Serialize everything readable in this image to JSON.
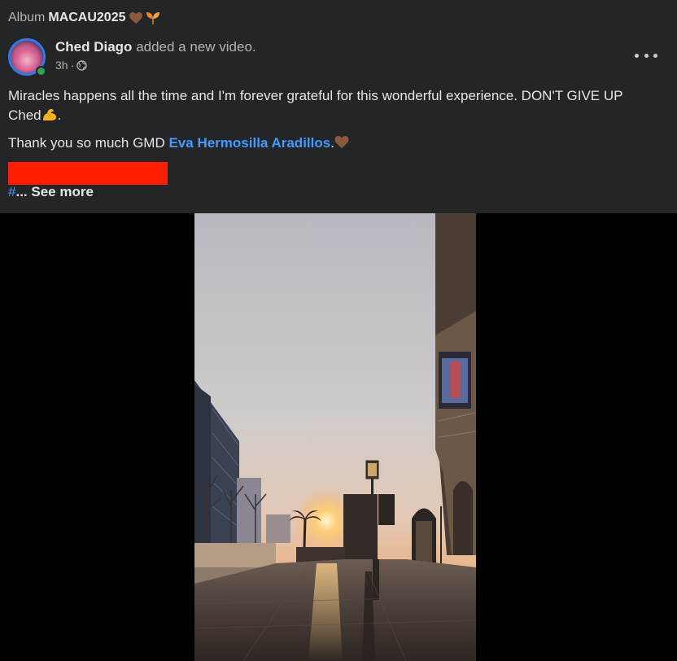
{
  "album": {
    "prefix": "Album",
    "name": "MACAU2025"
  },
  "post": {
    "author": "Ched Diago",
    "action": "added a new video.",
    "time": "3h",
    "privacy_icon": "globe-icon",
    "paragraph1_part1": "Miracles happens all the time and I'm forever grateful for this wonderful experience. DON'T GIVE UP Ched",
    "paragraph1_end": ".",
    "paragraph2_prefix": "Thank you so much GMD ",
    "mention": "Eva Hermosilla Aradillos",
    "paragraph2_end": ".",
    "hashtag": "#",
    "ellipsis": "...",
    "see_more": "See more"
  },
  "colors": {
    "background": "#242526",
    "text": "#e4e6eb",
    "secondary_text": "#b0b3b8",
    "link": "#4599ff",
    "online": "#31a24c",
    "redaction": "#ff1f00"
  }
}
